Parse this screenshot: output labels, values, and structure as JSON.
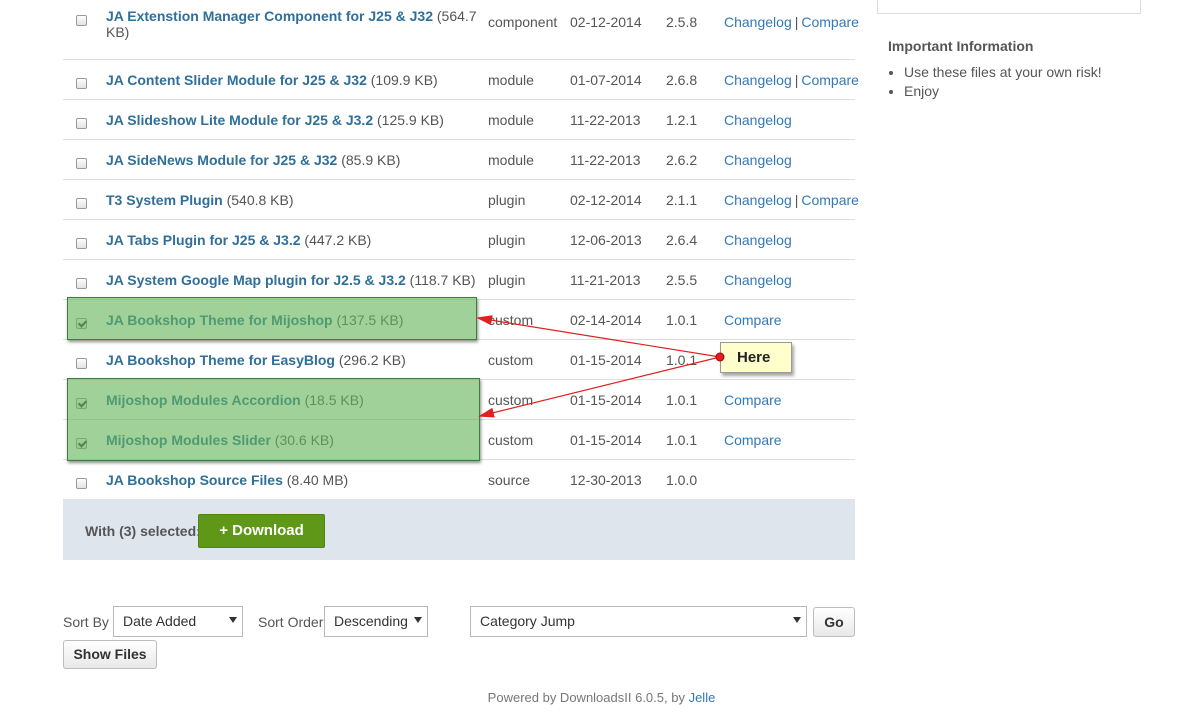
{
  "files": [
    {
      "name": "JA Extenstion Manager Component for J25 & J32",
      "size": "(564.7 KB)",
      "type": "component",
      "date": "02-12-2014",
      "version": "2.5.8",
      "changelog": "Changelog",
      "compare": "Compare",
      "checked": false
    },
    {
      "name": "JA Content Slider Module for J25 & J32",
      "size": "(109.9 KB)",
      "type": "module",
      "date": "01-07-2014",
      "version": "2.6.8",
      "changelog": "Changelog",
      "compare": "Compare",
      "checked": false
    },
    {
      "name": "JA Slideshow Lite Module for J25 & J3.2",
      "size": "(125.9 KB)",
      "type": "module",
      "date": "11-22-2013",
      "version": "1.2.1",
      "changelog": "Changelog",
      "compare": "",
      "checked": false
    },
    {
      "name": "JA SideNews Module for J25 & J32",
      "size": "(85.9 KB)",
      "type": "module",
      "date": "11-22-2013",
      "version": "2.6.2",
      "changelog": "Changelog",
      "compare": "",
      "checked": false
    },
    {
      "name": "T3 System Plugin",
      "size": "(540.8 KB)",
      "type": "plugin",
      "date": "02-12-2014",
      "version": "2.1.1",
      "changelog": "Changelog",
      "compare": "Compare",
      "checked": false
    },
    {
      "name": "JA Tabs Plugin for J25 & J3.2",
      "size": "(447.2 KB)",
      "type": "plugin",
      "date": "12-06-2013",
      "version": "2.6.4",
      "changelog": "Changelog",
      "compare": "",
      "checked": false
    },
    {
      "name": "JA System Google Map plugin for J2.5 & J3.2",
      "size": "(118.7 KB)",
      "type": "plugin",
      "date": "11-21-2013",
      "version": "2.5.5",
      "changelog": "Changelog",
      "compare": "",
      "checked": false
    },
    {
      "name": "JA Bookshop Theme for Mijoshop",
      "size": "(137.5 KB)",
      "type": "custom",
      "date": "02-14-2014",
      "version": "1.0.1",
      "changelog": "",
      "compare": "Compare",
      "checked": true
    },
    {
      "name": "JA Bookshop Theme for EasyBlog",
      "size": "(296.2 KB)",
      "type": "custom",
      "date": "01-15-2014",
      "version": "1.0.1",
      "changelog": "",
      "compare": "",
      "checked": false
    },
    {
      "name": "Mijoshop Modules Accordion",
      "size": "(18.5 KB)",
      "type": "custom",
      "date": "01-15-2014",
      "version": "1.0.1",
      "changelog": "",
      "compare": "Compare",
      "checked": true
    },
    {
      "name": "Mijoshop Modules Slider",
      "size": "(30.6 KB)",
      "type": "custom",
      "date": "01-15-2014",
      "version": "1.0.1",
      "changelog": "",
      "compare": "Compare",
      "checked": true
    },
    {
      "name": "JA Bookshop Source Files",
      "size": "(8.40 MB)",
      "type": "source",
      "date": "12-30-2013",
      "version": "1.0.0",
      "changelog": "",
      "compare": "",
      "checked": false
    }
  ],
  "link_separator": "|",
  "download_bar": {
    "label": "With (3) selected:",
    "button": "+ Download",
    "button_color": "#5f9818"
  },
  "sort": {
    "sort_by_label": "Sort By",
    "sort_by_value": "Date Added",
    "sort_order_label": "Sort Order",
    "sort_order_value": "Descending",
    "category_value": "Category Jump",
    "go_label": "Go",
    "show_files_label": "Show Files"
  },
  "footer": {
    "text": "Powered by DownloadsII 6.0.5, by",
    "author": "Jelle"
  },
  "sidebar": {
    "title": "Important Information",
    "items": [
      "Use these files at your own risk!",
      "Enjoy"
    ]
  },
  "annotation": {
    "callout": "Here",
    "arrow_color": "#e02020",
    "highlight_color": "#7cc07a"
  }
}
